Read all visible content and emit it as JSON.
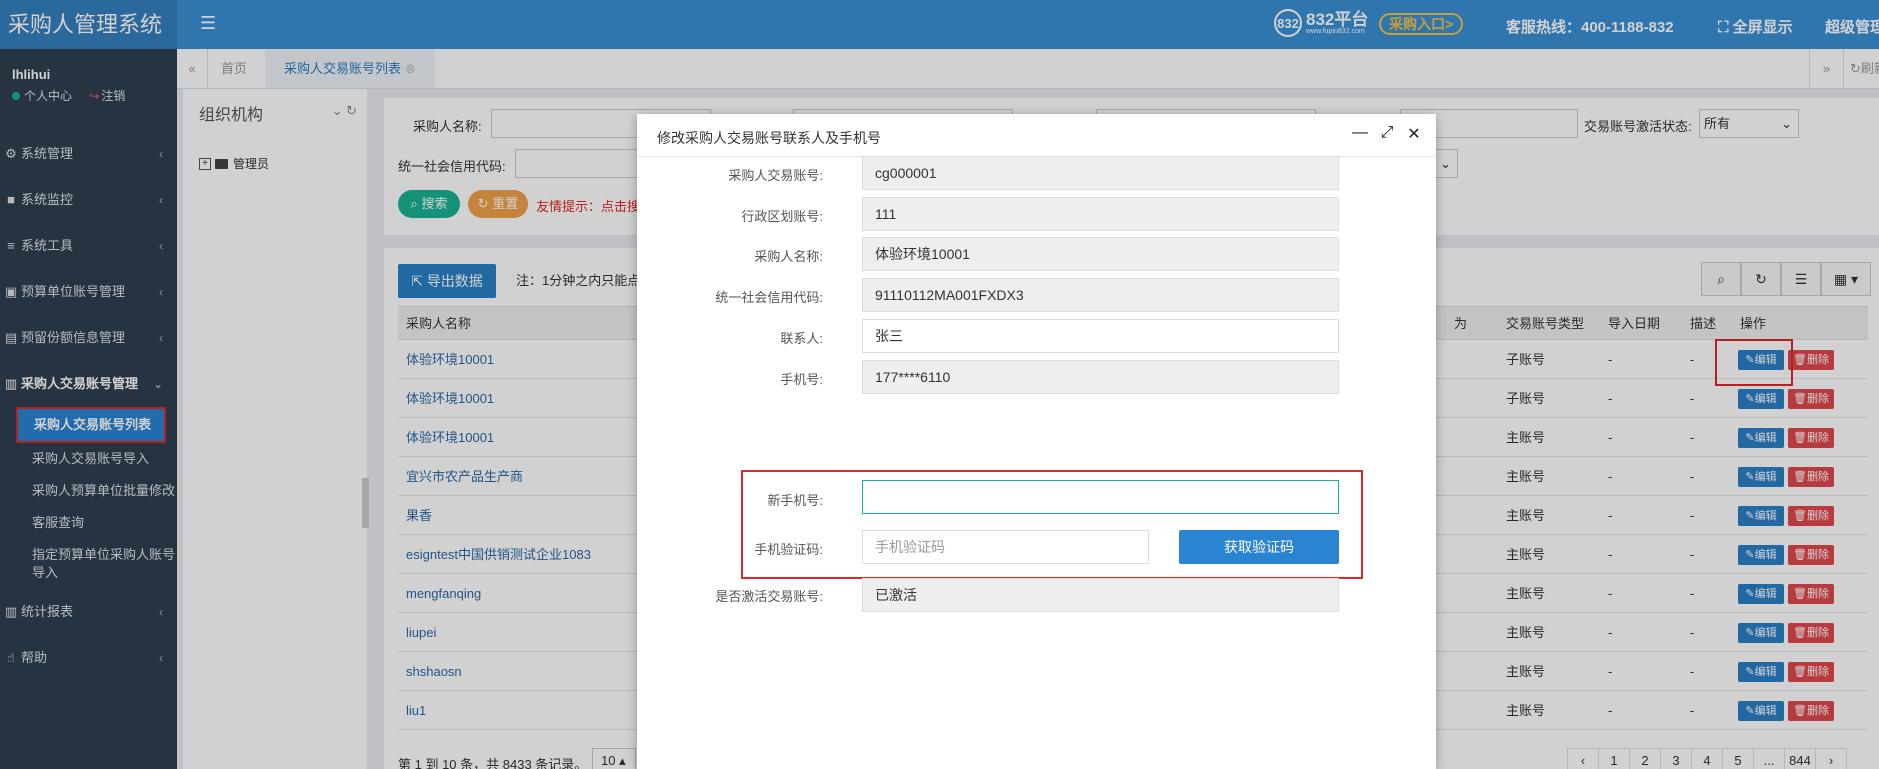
{
  "header": {
    "app_title": "采购人管理系统",
    "logo_badge": "832",
    "logo_text": "832平台",
    "logo_sub": "www.fupin832.com",
    "entry_button": "采购入口>",
    "hotline": "客服热线：400-1188-832",
    "fullscreen": "全屏显示",
    "admin": "超级管理"
  },
  "sidebar": {
    "user": "lhlihui",
    "profile_link": "个人中心",
    "logout_link": "注销",
    "items": [
      {
        "label": "系统管理"
      },
      {
        "label": "系统监控"
      },
      {
        "label": "系统工具"
      },
      {
        "label": "预算单位账号管理"
      },
      {
        "label": "预留份额信息管理"
      },
      {
        "label": "采购人交易账号管理"
      }
    ],
    "sub_items": [
      {
        "label": "采购人交易账号列表"
      },
      {
        "label": "采购人交易账号导入"
      },
      {
        "label": "采购人预算单位批量修改"
      },
      {
        "label": "客服查询"
      },
      {
        "label": "指定预算单位采购人账号导入"
      }
    ],
    "items_after": [
      {
        "label": "统计报表"
      },
      {
        "label": "帮助"
      }
    ]
  },
  "tabs": {
    "home": "首页",
    "current": "采购人交易账号列表",
    "refresh": "刷新"
  },
  "org": {
    "title": "组织机构",
    "node": "管理员"
  },
  "search": {
    "buyer_name_label": "采购人名称:",
    "credit_code_label": "统一社会信用代码:",
    "activation_label": "交易账号激活状态:",
    "activation_value": "所有",
    "search_button": "搜索",
    "reset_button": "重置",
    "tip": "友情提示：点击搜"
  },
  "table": {
    "export_button": "导出数据",
    "note": "注：1分钟之内只能点",
    "columns": {
      "name": "采购人名称",
      "behavior": "为",
      "type": "交易账号类型",
      "import_date": "导入日期",
      "desc": "描述",
      "ops": "操作"
    },
    "edit_label": "编辑",
    "delete_label": "删除",
    "rows": [
      {
        "name": "体验环境10001",
        "type": "子账号",
        "date": "-",
        "desc": "-"
      },
      {
        "name": "体验环境10001",
        "type": "子账号",
        "date": "-",
        "desc": "-"
      },
      {
        "name": "体验环境10001",
        "type": "主账号",
        "date": "-",
        "desc": "-"
      },
      {
        "name": "宜兴市农产品生产商",
        "type": "主账号",
        "date": "-",
        "desc": "-"
      },
      {
        "name": "果香",
        "type": "主账号",
        "date": "-",
        "desc": "-"
      },
      {
        "name": "esigntest中国供销测试企业1083",
        "type": "主账号",
        "date": "-",
        "desc": "-"
      },
      {
        "name": "mengfanqing",
        "type": "主账号",
        "date": "-",
        "desc": "-"
      },
      {
        "name": "liupei",
        "type": "主账号",
        "date": "-",
        "desc": "-"
      },
      {
        "name": "shshaosn",
        "type": "主账号",
        "date": "-",
        "desc": "-"
      },
      {
        "name": "liu1",
        "type": "主账号",
        "date": "-",
        "desc": "-"
      }
    ],
    "footer": "第 1 到 10 条，共 8433 条记录。",
    "page_size": "10",
    "pages": [
      "‹",
      "1",
      "2",
      "3",
      "4",
      "5",
      "...",
      "844",
      "›"
    ]
  },
  "modal": {
    "title": "修改采购人交易账号联系人及手机号",
    "fields": [
      {
        "label": "采购人交易账号:",
        "value": "cg000001"
      },
      {
        "label": "行政区划账号:",
        "value": "111"
      },
      {
        "label": "采购人名称:",
        "value": "体验环境10001"
      },
      {
        "label": "统一社会信用代码:",
        "value": "91110112MA001FXDX3"
      },
      {
        "label": "联系人:",
        "value": "张三"
      },
      {
        "label": "手机号:",
        "value": "177****6110"
      }
    ],
    "new_phone_label": "新手机号:",
    "new_phone_value": "",
    "code_label": "手机验证码:",
    "code_placeholder": "手机验证码",
    "get_code_button": "获取验证码",
    "activated_label": "是否激活交易账号:",
    "activated_value": "已激活"
  }
}
